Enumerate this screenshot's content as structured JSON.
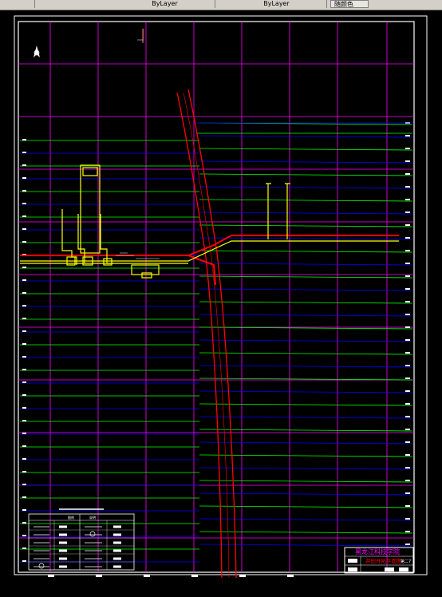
{
  "toolbar": {
    "tab1": "",
    "tab2": "ByLayer",
    "tab3": "ByLayer",
    "button": "随颜色"
  },
  "title_block": {
    "institution": "黑龙江科技学院",
    "drawing_name": "井田开拓平面图",
    "sheet": "第二7"
  },
  "legend": {
    "header1": "图例",
    "header2": "说明"
  },
  "colors": {
    "grid_magenta": "#ff00ff",
    "contour_green": "#00ff00",
    "contour_blue": "#0000ff",
    "roadway_red": "#ff0000",
    "shaft_yellow": "#ffff00",
    "frame_white": "#ffffff"
  },
  "icons": {
    "north": "north-arrow-icon"
  }
}
